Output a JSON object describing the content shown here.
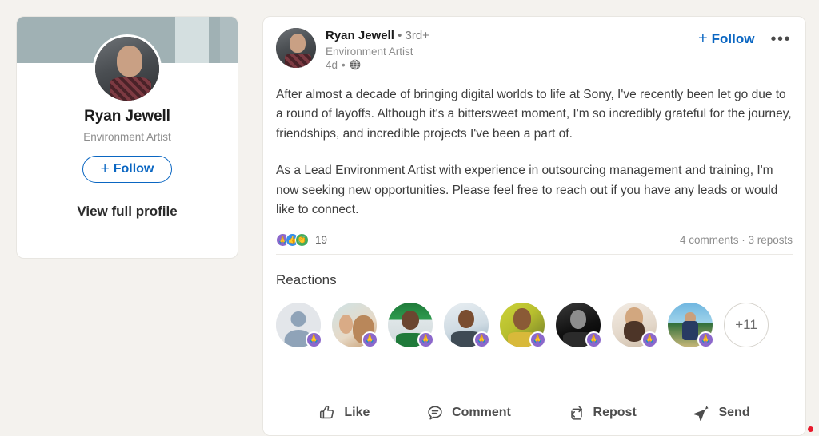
{
  "theme": {
    "page_bg": "#f4f2ee",
    "card_bg": "#ffffff",
    "accent_blue": "#0a66c2",
    "banner": "#a0b1b4",
    "support_purple": "#8c68cb",
    "like_blue": "#378fe9",
    "celebrate_green": "#44ab5c",
    "cursor_red": "#e8192c"
  },
  "profile_card": {
    "name": "Ryan Jewell",
    "headline": "Environment Artist",
    "follow_label": "Follow",
    "follow_plus": "+",
    "view_full_profile": "View full profile"
  },
  "post": {
    "author": {
      "name": "Ryan Jewell",
      "separator": "•",
      "degree": "3rd+",
      "headline": "Environment Artist",
      "age": "4d",
      "visibility_icon": "globe-icon"
    },
    "actions": {
      "follow_label": "Follow",
      "follow_plus": "+",
      "more_label": "•••"
    },
    "body": {
      "paragraph_1": "After almost a decade of bringing digital worlds to life at Sony, I've recently been let go due to a round of layoffs. Although it's a bittersweet moment, I'm so incredibly grateful for the journey, friendships, and incredible projects I've been a part of.",
      "paragraph_2": "As a Lead Environment Artist with experience in outsourcing management and training, I'm now seeking new opportunities. Please feel free to reach out if you have any leads or would like to connect."
    },
    "stats": {
      "reaction_icons": [
        "support-reaction-icon",
        "like-reaction-icon",
        "celebrate-reaction-icon"
      ],
      "reaction_count": "19",
      "comments_reposts": "4 comments · 3 reposts"
    },
    "reactions_section": {
      "title": "Reactions",
      "reactors": [
        {
          "badge": "support-reaction-badge",
          "art": "av-blank"
        },
        {
          "badge": "support-reaction-badge",
          "art": "av-g1"
        },
        {
          "badge": "support-reaction-badge",
          "art": "av-g2"
        },
        {
          "badge": "support-reaction-badge",
          "art": "av-g3"
        },
        {
          "badge": "support-reaction-badge",
          "art": "av-g4"
        },
        {
          "badge": "support-reaction-badge",
          "art": "av-g5"
        },
        {
          "badge": "support-reaction-badge",
          "art": "av-g6"
        },
        {
          "badge": "support-reaction-badge",
          "art": "av-g7"
        }
      ],
      "overflow_label": "+11"
    },
    "action_bar": [
      {
        "label": "Like",
        "icon": "thumbs-up-icon"
      },
      {
        "label": "Comment",
        "icon": "comment-bubble-icon"
      },
      {
        "label": "Repost",
        "icon": "repost-arrows-icon"
      },
      {
        "label": "Send",
        "icon": "send-paper-plane-icon"
      }
    ]
  }
}
